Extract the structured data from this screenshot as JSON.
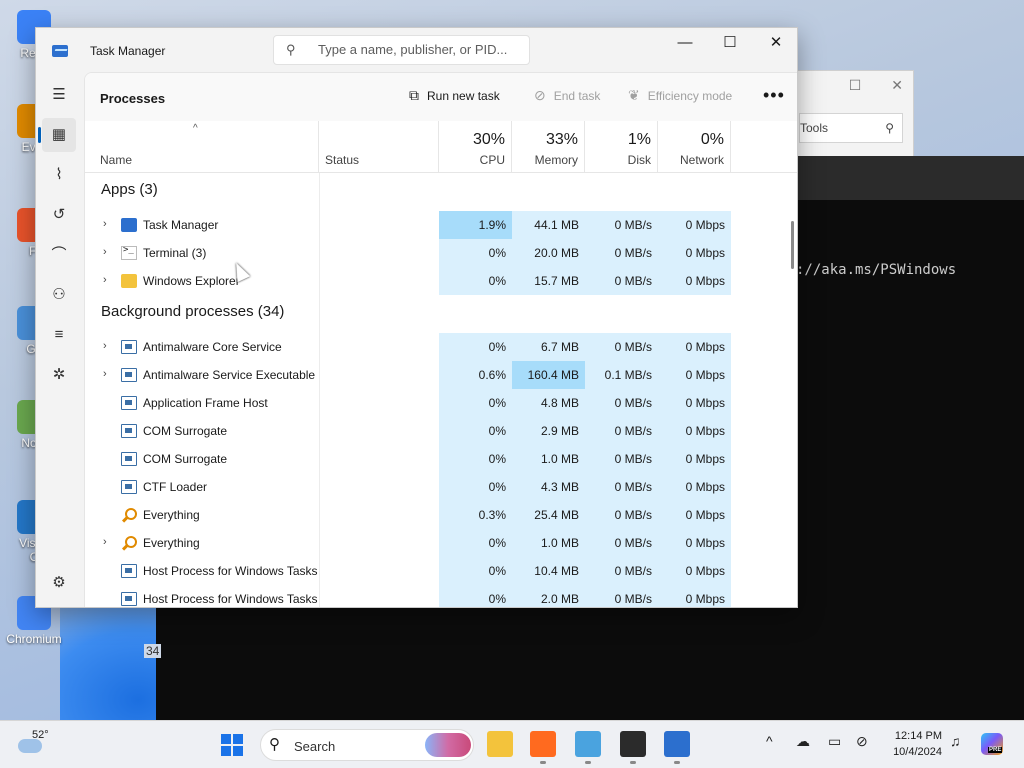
{
  "desktop": {
    "icons": [
      {
        "label": "Recy",
        "color": "#3b82f6"
      },
      {
        "label": "Ever",
        "color": "#e08a00"
      },
      {
        "label": "Fi",
        "color": "#e8532b"
      },
      {
        "label": "Git",
        "color": "#4a90d9"
      },
      {
        "label": "Note",
        "color": "#6aa84f"
      },
      {
        "label": "Visua\nC",
        "color": "#2477c8"
      },
      {
        "label": "Chromium",
        "color": "#4285f4"
      }
    ],
    "background_number": "34"
  },
  "explorer_bg": {
    "search_placeholder": "Tools",
    "search_icon": "search-icon"
  },
  "terminal_bg": {
    "visible_text": "://aka.ms/PSWindows"
  },
  "task_manager": {
    "window_title": "Task Manager",
    "search_placeholder": "Type a name, publisher, or PID...",
    "nav": [
      {
        "icon": "hamburger-icon",
        "glyph": "☰",
        "active": false
      },
      {
        "icon": "processes-icon",
        "glyph": "▦",
        "active": true
      },
      {
        "icon": "performance-icon",
        "glyph": "⌇",
        "active": false
      },
      {
        "icon": "app-history-icon",
        "glyph": "↺",
        "active": false
      },
      {
        "icon": "startup-apps-icon",
        "glyph": "⌒",
        "active": false
      },
      {
        "icon": "users-icon",
        "glyph": "⚇",
        "active": false
      },
      {
        "icon": "details-icon",
        "glyph": "≡",
        "active": false
      },
      {
        "icon": "services-icon",
        "glyph": "✲",
        "active": false
      },
      {
        "icon": "settings-icon",
        "glyph": "⚙",
        "active": false
      }
    ],
    "page_title": "Processes",
    "commands": {
      "run_new_task": "Run new task",
      "end_task": "End task",
      "efficiency_mode": "Efficiency mode",
      "more": "•••"
    },
    "columns": {
      "name": "Name",
      "status": "Status",
      "cpu": {
        "pct": "30%",
        "label": "CPU"
      },
      "memory": {
        "pct": "33%",
        "label": "Memory"
      },
      "disk": {
        "pct": "1%",
        "label": "Disk"
      },
      "network": {
        "pct": "0%",
        "label": "Network"
      }
    },
    "groups": [
      {
        "title": "Apps (3)",
        "rows": [
          {
            "name": "Task Manager",
            "expandable": true,
            "icon": "task-manager-icon",
            "cpu": "1.9%",
            "memory": "44.1 MB",
            "disk": "0 MB/s",
            "network": "0 Mbps",
            "hot": "cpu"
          },
          {
            "name": "Terminal (3)",
            "expandable": true,
            "icon": "terminal-icon",
            "cpu": "0%",
            "memory": "20.0 MB",
            "disk": "0 MB/s",
            "network": "0 Mbps",
            "hot": ""
          },
          {
            "name": "Windows Explorer",
            "expandable": true,
            "icon": "folder-icon",
            "cpu": "0%",
            "memory": "15.7 MB",
            "disk": "0 MB/s",
            "network": "0 Mbps",
            "hot": ""
          }
        ]
      },
      {
        "title": "Background processes (34)",
        "rows": [
          {
            "name": "Antimalware Core Service",
            "expandable": true,
            "icon": "process-icon",
            "cpu": "0%",
            "memory": "6.7 MB",
            "disk": "0 MB/s",
            "network": "0 Mbps",
            "hot": ""
          },
          {
            "name": "Antimalware Service Executable",
            "expandable": true,
            "icon": "process-icon",
            "cpu": "0.6%",
            "memory": "160.4 MB",
            "disk": "0.1 MB/s",
            "network": "0 Mbps",
            "hot": "memory"
          },
          {
            "name": "Application Frame Host",
            "expandable": false,
            "icon": "process-icon",
            "cpu": "0%",
            "memory": "4.8 MB",
            "disk": "0 MB/s",
            "network": "0 Mbps",
            "hot": ""
          },
          {
            "name": "COM Surrogate",
            "expandable": false,
            "icon": "process-icon",
            "cpu": "0%",
            "memory": "2.9 MB",
            "disk": "0 MB/s",
            "network": "0 Mbps",
            "hot": ""
          },
          {
            "name": "COM Surrogate",
            "expandable": false,
            "icon": "process-icon",
            "cpu": "0%",
            "memory": "1.0 MB",
            "disk": "0 MB/s",
            "network": "0 Mbps",
            "hot": ""
          },
          {
            "name": "CTF Loader",
            "expandable": false,
            "icon": "process-icon",
            "cpu": "0%",
            "memory": "4.3 MB",
            "disk": "0 MB/s",
            "network": "0 Mbps",
            "hot": ""
          },
          {
            "name": "Everything",
            "expandable": false,
            "icon": "everything-icon",
            "cpu": "0.3%",
            "memory": "25.4 MB",
            "disk": "0 MB/s",
            "network": "0 Mbps",
            "hot": ""
          },
          {
            "name": "Everything",
            "expandable": true,
            "icon": "everything-icon",
            "cpu": "0%",
            "memory": "1.0 MB",
            "disk": "0 MB/s",
            "network": "0 Mbps",
            "hot": ""
          },
          {
            "name": "Host Process for Windows Tasks",
            "expandable": false,
            "icon": "process-icon",
            "cpu": "0%",
            "memory": "10.4 MB",
            "disk": "0 MB/s",
            "network": "0 Mbps",
            "hot": ""
          },
          {
            "name": "Host Process for Windows Tasks",
            "expandable": false,
            "icon": "process-icon",
            "cpu": "0%",
            "memory": "2.0 MB",
            "disk": "0 MB/s",
            "network": "0 Mbps",
            "hot": ""
          }
        ]
      }
    ],
    "colors": {
      "cell": "#daf0fd",
      "cell_hot": "#a7dcfa",
      "accent": "#005fb8"
    }
  },
  "taskbar": {
    "weather_temp": "52°",
    "search_label": "Search",
    "time": "12:14 PM",
    "date": "10/4/2024",
    "pinned": [
      {
        "icon": "file-explorer-icon",
        "color": "#f3c33c",
        "running": false
      },
      {
        "icon": "firefox-icon",
        "color": "#ff6a1f",
        "running": true
      },
      {
        "icon": "control-panel-icon",
        "color": "#4aa3df",
        "running": true
      },
      {
        "icon": "terminal-icon",
        "color": "#2b2b2b",
        "running": true
      },
      {
        "icon": "task-manager-icon",
        "color": "#2c6fce",
        "running": true
      }
    ],
    "copilot_badge": "PRE"
  }
}
